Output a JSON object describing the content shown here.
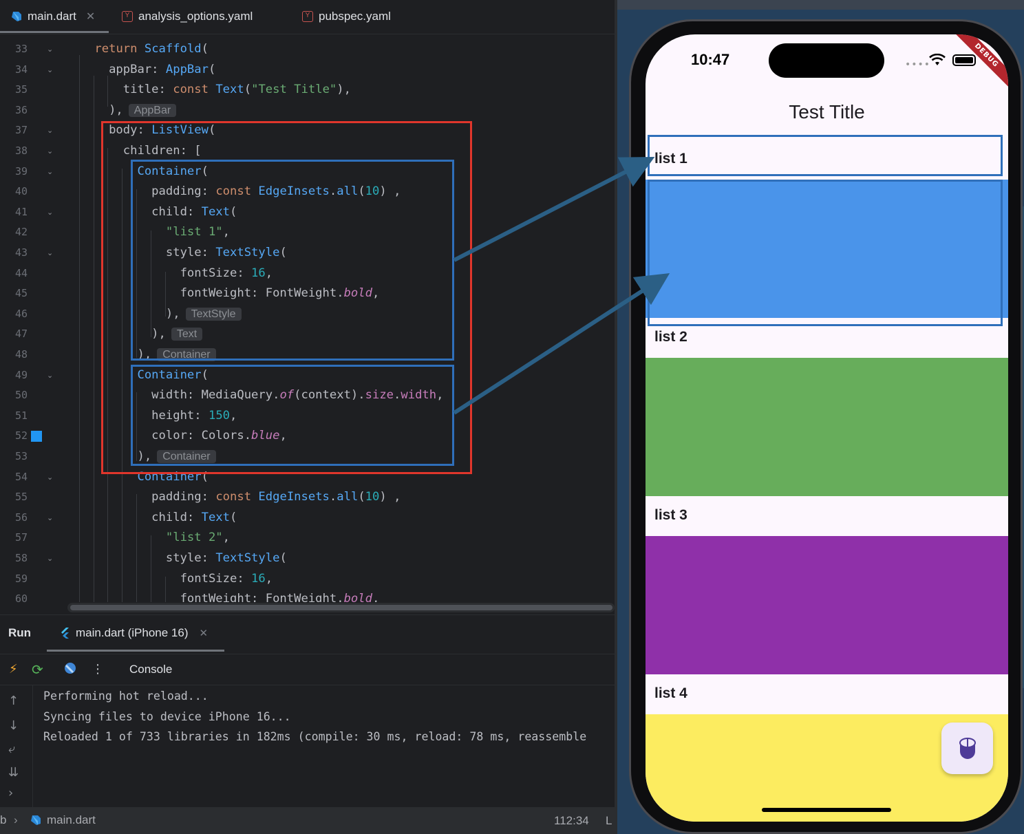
{
  "ide": {
    "tabs": [
      {
        "label": "main.dart",
        "active": true
      },
      {
        "label": "analysis_options.yaml",
        "active": false
      },
      {
        "label": "pubspec.yaml",
        "active": false
      }
    ],
    "line_numbers": [
      "33",
      "34",
      "35",
      "36",
      "37",
      "38",
      "39",
      "40",
      "41",
      "42",
      "43",
      "44",
      "45",
      "46",
      "47",
      "48",
      "49",
      "50",
      "51",
      "52",
      "53",
      "54",
      "55",
      "56",
      "57",
      "58",
      "59",
      "60"
    ],
    "hints": {
      "appbar": "AppBar",
      "textstyle": "TextStyle",
      "text": "Text",
      "container1": "Container",
      "container2": "Container"
    },
    "run": {
      "title": "Run",
      "tab_label": "main.dart (iPhone 16)",
      "console_label": "Console",
      "lines": [
        "Performing hot reload...",
        "Syncing files to device iPhone 16...",
        "Reloaded 1 of 733 libraries in 182ms (compile: 30 ms, reload: 78 ms, reassemble"
      ]
    },
    "status": {
      "left_glyph": "b",
      "file": "main.dart",
      "position": "112:34",
      "right_glyph": "L"
    }
  },
  "phone": {
    "time": "10:47",
    "debug_banner": "DEBUG",
    "appbar_title": "Test Title",
    "items": [
      {
        "label": "list 1",
        "color": "#4a94ea"
      },
      {
        "label": "list 2",
        "color": "#67ad5b"
      },
      {
        "label": "list 3",
        "color": "#8f30a9"
      },
      {
        "label": "list 4",
        "color": "#fcec60"
      }
    ]
  },
  "annotation_colors": {
    "outer": "#e0362c",
    "inner": "#2f6fba",
    "arrow": "#2b5f85"
  }
}
